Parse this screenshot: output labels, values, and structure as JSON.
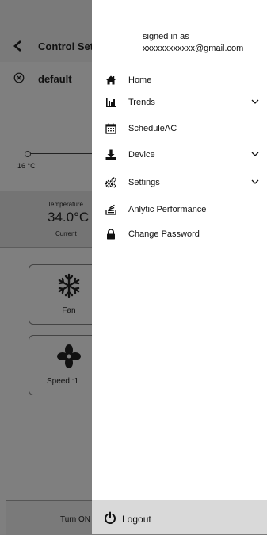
{
  "background": {
    "title": "Control Set",
    "profile_name": "default",
    "slider_min": "16 °C",
    "temperature": {
      "label": "Temperature",
      "value": "34.0°C",
      "sub": "Current"
    },
    "cards": [
      {
        "label": "Fan",
        "icon": "snowflake-icon"
      },
      {
        "label": "Speed :1",
        "icon": "fan-icon"
      }
    ],
    "bottom_label": "Turn ON"
  },
  "drawer": {
    "signed_label": "signed in as",
    "email": "xxxxxxxxxxxx@gmail.com",
    "items": [
      {
        "label": "Home",
        "icon": "home-icon",
        "expandable": false
      },
      {
        "label": "Trends",
        "icon": "bar-chart-icon",
        "expandable": true
      },
      {
        "label": "ScheduleAC",
        "icon": "calendar-icon",
        "expandable": false
      },
      {
        "label": "Device",
        "icon": "download-icon",
        "expandable": true
      },
      {
        "label": "Settings",
        "icon": "gears-icon",
        "expandable": true
      },
      {
        "label": "Anlytic Performance",
        "icon": "stack-icon",
        "expandable": false
      },
      {
        "label": "Change Password",
        "icon": "lock-icon",
        "expandable": false
      }
    ],
    "logout_label": "Logout"
  }
}
